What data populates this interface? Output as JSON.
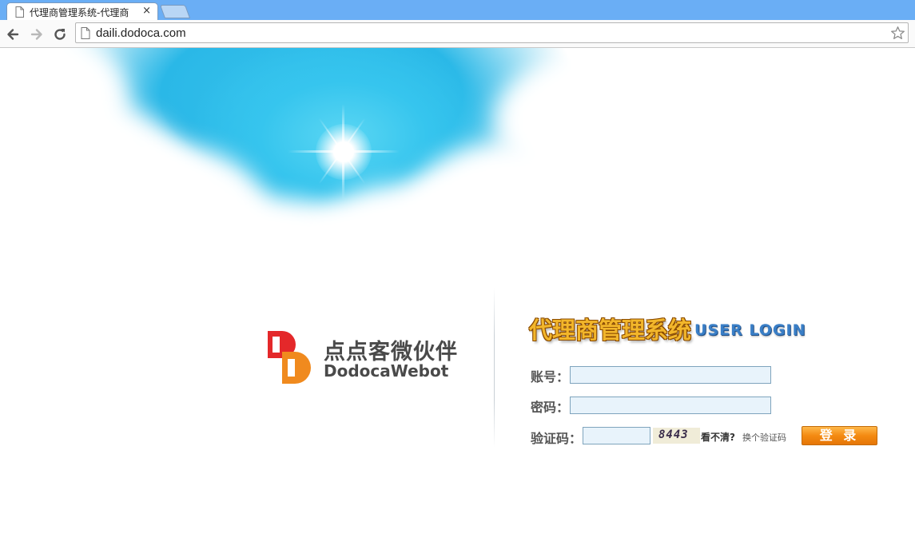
{
  "browser": {
    "tab_title": "代理商管理系统-代理商",
    "tab_close": "×",
    "url": "daili.dodoca.com",
    "icons": [
      "page-icon",
      "back-arrow-icon",
      "forward-arrow-icon",
      "reload-icon",
      "star-icon"
    ]
  },
  "brand": {
    "name_cn": "点点客微伙伴",
    "name_en": "DodocaWebot",
    "logo_colors": [
      "#e4282a",
      "#f08a1e"
    ]
  },
  "login": {
    "title": "代理商管理系统",
    "subtitle": "USER LOGIN",
    "account_label": "账号：",
    "account_value": "",
    "password_label": "密码：",
    "password_value": "",
    "captcha_label": "验证码：",
    "captcha_value": "",
    "captcha_image_text": "8443",
    "unclear_text": "看不清?",
    "change_link": "换个验证码",
    "submit_label": "登 录"
  },
  "colors": {
    "sky": "#2ab8e7",
    "title_gold": "#f2b62b",
    "login_blue": "#3a7fc7",
    "button_orange": "#f48a12",
    "field_bg": "#e8f3fb"
  }
}
